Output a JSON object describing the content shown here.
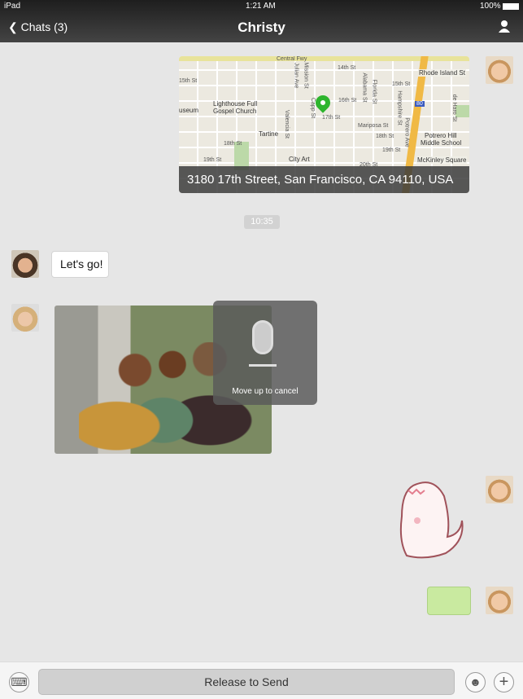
{
  "status_bar": {
    "device": "iPad",
    "time": "1:21 AM",
    "battery": "100%"
  },
  "nav": {
    "back_label": "Chats (3)",
    "title": "Christy",
    "profile_icon": "person-icon"
  },
  "map": {
    "address": "3180 17th Street, San Francisco, CA 94110, USA",
    "labels": [
      "Central Fwy",
      "14th St",
      "15th St",
      "15th St",
      "16th St",
      "17th St",
      "18th St",
      "18th St",
      "19th St",
      "19th St",
      "20th St",
      "Julian Ave",
      "Mission St",
      "Capp St",
      "Valencia St",
      "Lighthouse Full",
      "Gospel Church",
      "useum",
      "Tartine",
      "City Art",
      "Alabama St",
      "Florida St",
      "Mariposa St",
      "Hampshire St",
      "Potrero Ave",
      "Potrero Hill",
      "Middle School",
      "Rhode Island St",
      "de Haro St",
      "McKinley Square",
      "80"
    ]
  },
  "timestamp": "10:35",
  "messages": {
    "lets_go": "Let's go!"
  },
  "voice_overlay": {
    "hint": "Move up to cancel"
  },
  "input_bar": {
    "hold_label": "Release to Send"
  },
  "colors": {
    "accent_green": "#2db52d",
    "sent_bubble": "#c9eaa0"
  }
}
